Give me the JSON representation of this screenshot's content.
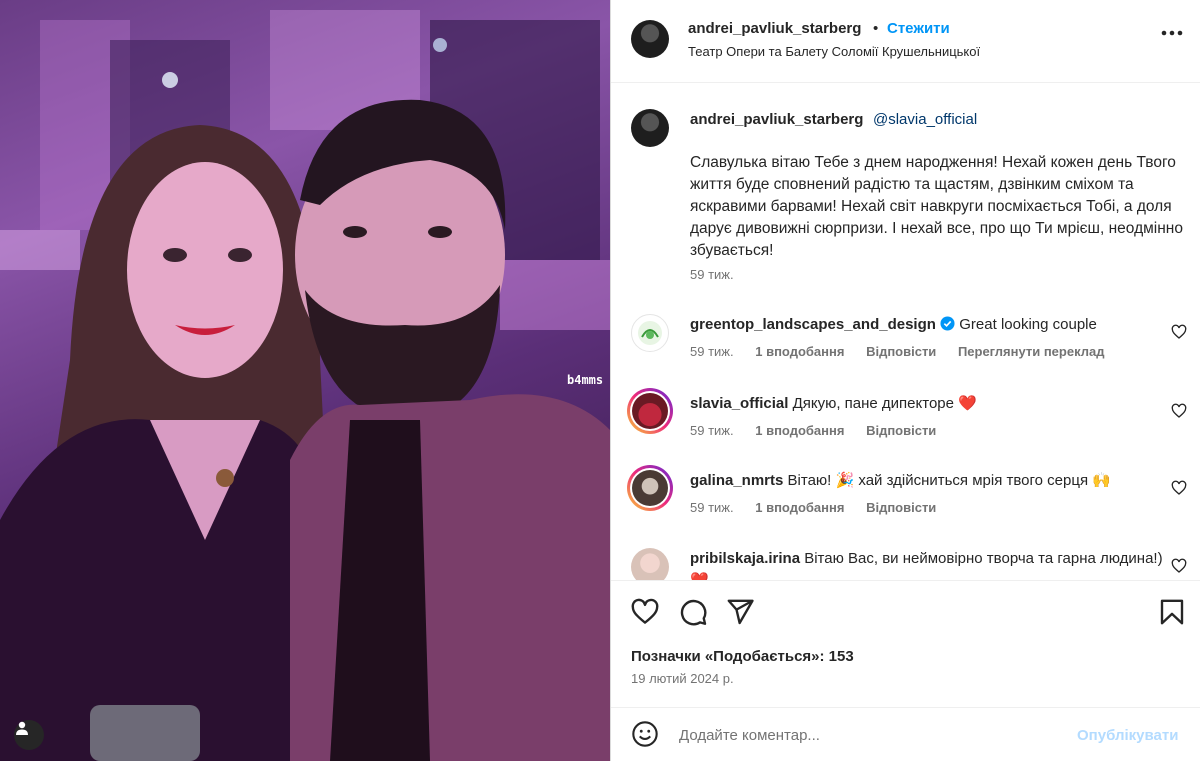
{
  "photo": {
    "alt": "",
    "watermark": "b4mms"
  },
  "header": {
    "username": "andrei_pavliuk_starberg",
    "dot": "•",
    "follow_label": "Стежити",
    "location": "Театр Опери та Балету Соломії Крушельницької",
    "more_icon": "more-horizontal-icon"
  },
  "caption": {
    "username": "andrei_pavliuk_starberg",
    "mention": "@slavia_official",
    "text": "Славулька вітаю Тебе з днем народження! Нехай кожен день Твого життя буде сповнений радістю та щастям, дзвінким сміхом та яскравими барвами! Нехай світ навкруги посміхається Тобі, а доля дарує дивовижні сюрпризи. І нехай все, про що Ти мрієш, неодмінно збувається!",
    "time": "59 тиж."
  },
  "comments": [
    {
      "username": "greentop_landscapes_and_design",
      "verified": true,
      "text": "Great looking couple",
      "time": "59 тиж.",
      "likes": "1 вподобання",
      "reply": "Відповісти",
      "translate": "Переглянути переклад"
    },
    {
      "username": "slavia_official",
      "text": "Дякую, пане дипекторе ❤️",
      "time": "59 тиж.",
      "likes": "1 вподобання",
      "reply": "Відповісти"
    },
    {
      "username": "galina_nmrts",
      "text": "Вітаю! 🎉 хай здійсниться мрія твого серця 🙌",
      "time": "59 тиж.",
      "likes": "1 вподобання",
      "reply": "Відповісти"
    },
    {
      "username": "pribilskaja.irina",
      "text": "Вітаю Вас, ви неймовірно творча та гарна людина!) ❤️"
    }
  ],
  "actions": {
    "likes_label": "Позначки «Подобається»: 153",
    "date": "19 лютий 2024 р."
  },
  "add_comment": {
    "placeholder": "Додайте коментар...",
    "publish_label": "Опублікувати"
  },
  "colors": {
    "link": "#0095f6",
    "mention": "#00376b",
    "muted": "#737373",
    "publish_disabled": "#b3dbff",
    "heart_red": "#ed4956"
  }
}
